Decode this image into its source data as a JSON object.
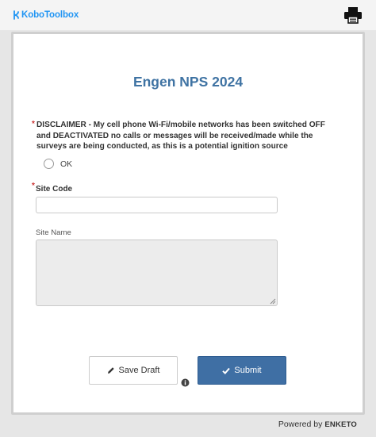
{
  "header": {
    "logo_text": "KoboToolbox",
    "print_icon": "printer-icon"
  },
  "form": {
    "title": "Engen NPS 2024",
    "questions": {
      "disclaimer": {
        "required_mark": "*",
        "label": "DISCLAIMER - My cell phone Wi-Fi/mobile networks has been switched OFF and DEACTIVATED no calls or messages will be received/made while the surveys are being conducted, as this is a potential ignition source",
        "options": [
          {
            "label": "OK",
            "selected": false
          }
        ]
      },
      "site_code": {
        "required_mark": "*",
        "label": "Site Code",
        "value": "",
        "placeholder": ""
      },
      "site_name": {
        "label": "Site Name",
        "value": "",
        "readonly": true
      }
    },
    "buttons": {
      "save_draft": "Save Draft",
      "submit": "Submit",
      "info_icon": "info-icon"
    }
  },
  "footer": {
    "powered_by": "Powered by",
    "brand": "ENKETO"
  },
  "colors": {
    "title": "#3f73a3",
    "submit_bg": "#3f6fa4",
    "brand_blue": "#2095f3",
    "page_bg": "#e6e6e6"
  }
}
